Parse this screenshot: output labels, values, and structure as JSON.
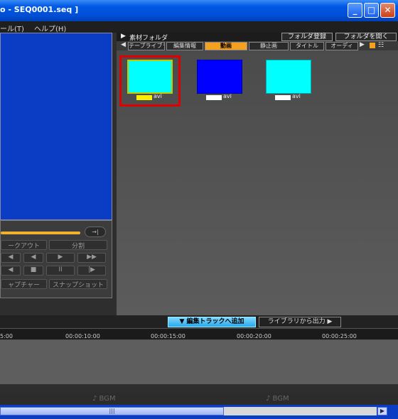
{
  "window": {
    "title": "- SEQ0001.seq ]",
    "title_prefix": "o"
  },
  "window_buttons": {
    "minimize": "_",
    "maximize": "□",
    "close": "✕"
  },
  "menu": [
    {
      "label": "ール(T)"
    },
    {
      "label": "ヘルプ(H)"
    }
  ],
  "right_panel": {
    "folder_label": "素材フォルダ",
    "register_folder": "フォルダ登録",
    "open_folder": "フォルダを開く",
    "tabs": [
      {
        "label": "テープライブラリ"
      },
      {
        "label": "編集情報"
      },
      {
        "label": "動画"
      },
      {
        "label": "静止画"
      },
      {
        "label": "タイトル"
      },
      {
        "label": "オーディ"
      }
    ],
    "thumbnails": [
      {
        "label": "avi",
        "selected": true,
        "color": "#00ffff",
        "tag_color": "#ffee00"
      },
      {
        "label": "avi",
        "selected": false,
        "color": "#0000ff",
        "tag_color": "#ffffff"
      },
      {
        "label": "avi",
        "selected": false,
        "color": "#00ffff",
        "tag_color": "#ffffff"
      }
    ]
  },
  "controls": {
    "mark_out": "ークアウト",
    "split": "分割",
    "capture": "ャプチャー",
    "snapshot": "スナップショット",
    "jump_label": "→|",
    "transport": [
      "◀",
      "◀",
      "▶",
      "▶▶",
      "◀",
      "■",
      "II",
      "|▶"
    ]
  },
  "actions": {
    "add_to_track": "▼ 編集トラックへ追加",
    "export_from_library": "ライブラリから出力 ▶"
  },
  "timeline": {
    "ticks": [
      "5:00",
      "00:00:10:00",
      "00:00:15:00",
      "00:00:20:00",
      "00:00:25:00"
    ],
    "bgm_label": "♪ BGM"
  },
  "scrollbar": {
    "grip": "|||"
  },
  "colors": {
    "accent_tab": "#f4a020",
    "selection": "#e00000",
    "add_button": "#2aa8e8"
  }
}
